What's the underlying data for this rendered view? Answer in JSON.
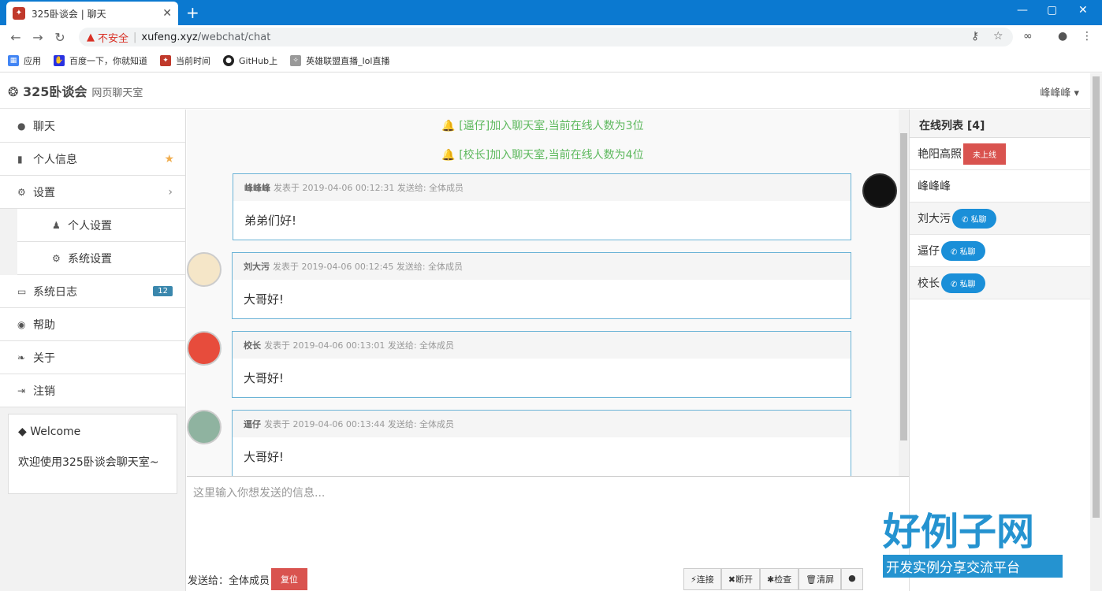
{
  "browser": {
    "tab_title": "325卧谈会 | 聊天",
    "url_warning": "不安全",
    "url_host": "xufeng.xyz",
    "url_path": "/webchat/chat"
  },
  "bookmarks": [
    {
      "label": "应用"
    },
    {
      "label": "百度一下，你就知道"
    },
    {
      "label": "当前时间"
    },
    {
      "label": "GitHub上"
    },
    {
      "label": "英雄联盟直播_lol直播"
    }
  ],
  "header": {
    "brand": "325卧谈会",
    "subtitle": "网页聊天室",
    "user": "峰峰峰 ▾"
  },
  "sidebar": {
    "items": [
      {
        "label": "聊天"
      },
      {
        "label": "个人信息"
      },
      {
        "label": "设置"
      },
      {
        "label": "个人设置"
      },
      {
        "label": "系统设置"
      },
      {
        "label": "系统日志",
        "badge": "12"
      },
      {
        "label": "帮助"
      },
      {
        "label": "关于"
      },
      {
        "label": "注销"
      }
    ],
    "welcome_title": "Welcome",
    "welcome_text": "欢迎使用325卧谈会聊天室~"
  },
  "chat": {
    "system": [
      "[逼仔]加入聊天室,当前在线人数为3位",
      "[校长]加入聊天室,当前在线人数为4位"
    ],
    "messages": [
      {
        "name": "峰峰峰",
        "meta": "发表于 2019-04-06 00:12:31 发送给: 全体成员",
        "text": "弟弟们好!"
      },
      {
        "name": "刘大污",
        "meta": "发表于 2019-04-06 00:12:45 发送给: 全体成员",
        "text": "大哥好!"
      },
      {
        "name": "校长",
        "meta": "发表于 2019-04-06 00:13:01 发送给: 全体成员",
        "text": "大哥好!"
      },
      {
        "name": "逼仔",
        "meta": "发表于 2019-04-06 00:13:44 发送给: 全体成员",
        "text": "大哥好!"
      }
    ]
  },
  "input": {
    "placeholder": "这里输入你想发送的信息...",
    "send_to": "发送给：全体成员",
    "reset": "复位",
    "buttons": [
      "连接",
      "断开",
      "检查",
      "清屏"
    ]
  },
  "online": {
    "title": "在线列表 [4]",
    "users": [
      {
        "name": "艳阳高照",
        "tag": "未上线"
      },
      {
        "name": "峰峰峰",
        "tag": ""
      },
      {
        "name": "刘大污",
        "tag": "私聊"
      },
      {
        "name": "逼仔",
        "tag": "私聊"
      },
      {
        "name": "校长",
        "tag": "私聊"
      }
    ]
  },
  "watermark": {
    "big": "好例子网",
    "small": "开发实例分享交流平台"
  }
}
